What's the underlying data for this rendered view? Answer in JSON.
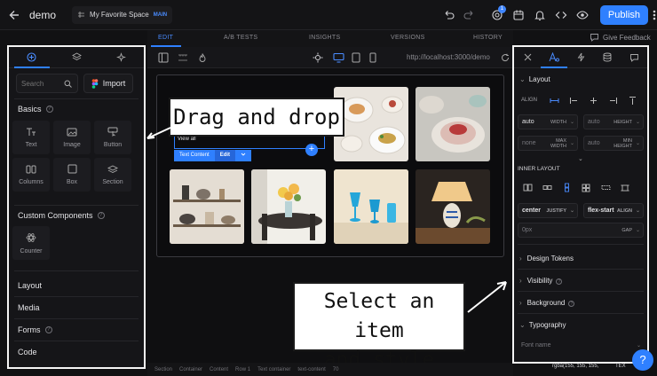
{
  "app": {
    "title": "demo"
  },
  "space": {
    "name": "My Favorite Space",
    "badge": "MAIN"
  },
  "topbar": {
    "publish_label": "Publish",
    "notification_count": "1"
  },
  "tabs": [
    "EDIT",
    "A/B TESTS",
    "INSIGHTS",
    "VERSIONS",
    "HISTORY"
  ],
  "give_feedback": "Give Feedback",
  "left_panel": {
    "search_placeholder": "Search",
    "import_label": "Import",
    "basics_title": "Basics",
    "basics_items": [
      "Text",
      "Image",
      "Button",
      "Columns",
      "Box",
      "Section"
    ],
    "custom_title": "Custom Components",
    "custom_items": [
      "Counter"
    ],
    "folds": [
      "Layout",
      "Media",
      "Forms",
      "Code"
    ]
  },
  "canvas": {
    "url": "http://localhost:3000/demo",
    "view_all": "View all",
    "selection_label": "Text Content",
    "selection_edit": "Edit",
    "breadcrumb": [
      "Section",
      "Container",
      "Content",
      "Row 1",
      "Text container",
      "text-content"
    ],
    "breadcrumb_tail": "70"
  },
  "callouts": {
    "drag": "Drag and drop",
    "select_line1": "Select an item",
    "select_line2": "and style"
  },
  "right_panel": {
    "layout_title": "Layout",
    "align_label": "ALIGN",
    "width_value": "auto",
    "width_label": "WIDTH",
    "height_value": "auto",
    "height_label": "HEIGHT",
    "maxw_value": "none",
    "maxw_label": "MAX WIDTH",
    "minh_value": "auto",
    "minh_label": "MIN HEIGHT",
    "inner_layout": "INNER LAYOUT",
    "justify_value": "center",
    "justify_label": "JUSTIFY",
    "align_value": "flex-start",
    "align_label2": "ALIGN",
    "gap_value": "0px",
    "gap_label": "GAP",
    "sections": [
      "Design Tokens",
      "Visibility",
      "Background",
      "Typography"
    ],
    "font_name_placeholder": "Font name",
    "rgba_text": "rgba(155, 155, 155,",
    "tex_text": "TEX"
  },
  "colors": {
    "accent": "#2f80ff",
    "panel": "#151518",
    "bg": "#111113"
  }
}
